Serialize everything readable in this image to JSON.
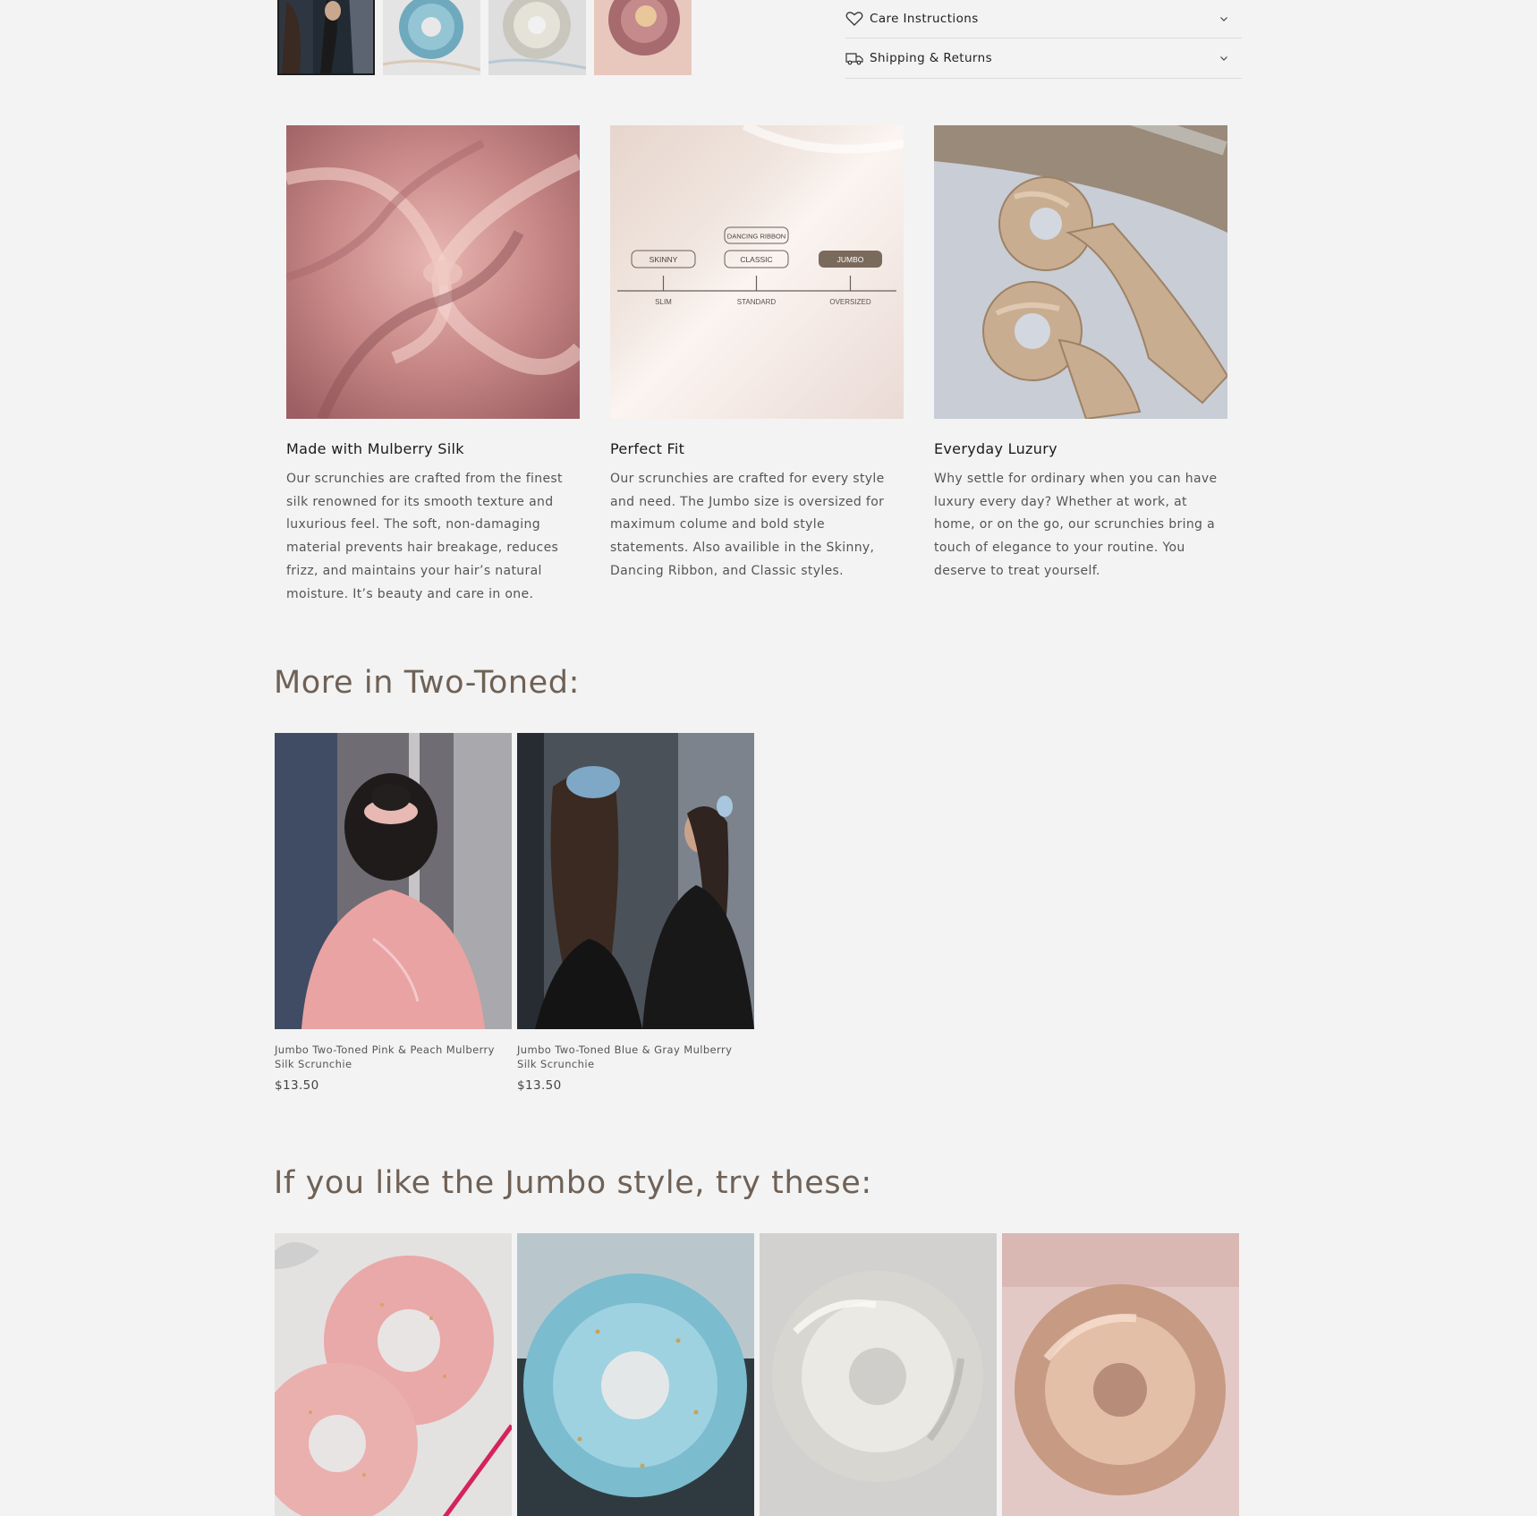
{
  "gallery": {
    "thumbnails": [
      {
        "alt": "two-toned-scrunchie-model"
      },
      {
        "alt": "blue-scrunchie"
      },
      {
        "alt": "silver-scrunchie"
      },
      {
        "alt": "rose-scrunchie"
      }
    ]
  },
  "accordions": [
    {
      "label": "Care Instructions",
      "icon": "heart-icon"
    },
    {
      "label": "Shipping & Returns",
      "icon": "truck-icon"
    }
  ],
  "features": [
    {
      "title": "Made with Mulberry Silk",
      "text": "Our scrunchies are crafted from the finest silk renowned for its smooth texture and luxurious feel. The soft, non-damaging material prevents hair breakage, reduces frizz, and maintains your hair’s natural moisture. It’s beauty and care in one."
    },
    {
      "title": "Perfect Fit",
      "text": "Our scrunchies are crafted for every style and need. The Jumbo size is oversized for maximum colume and bold style statements. Also availible in the Skinny, Dancing Ribbon, and Classic styles.",
      "size_chart": {
        "top_label": "DANCING RIBBON",
        "labels": [
          "SKINNY",
          "CLASSIC",
          "JUMBO"
        ],
        "axis": [
          "SLIM",
          "STANDARD",
          "OVERSIZED"
        ]
      }
    },
    {
      "title": "Everyday Luzury",
      "text": "Why settle for ordinary when you can have luxury every day? Whether at work, at home, or on the go, our scrunchies bring a touch of elegance to your routine. You deserve to treat yourself."
    }
  ],
  "more_two_toned": {
    "heading": "More in Two-Toned:",
    "products": [
      {
        "title": "Jumbo Two-Toned Pink & Peach Mulberry Silk Scrunchie",
        "price": "$13.50"
      },
      {
        "title": "Jumbo Two-Toned Blue & Gray Mulberry Silk Scrunchie",
        "price": "$13.50"
      }
    ]
  },
  "jumbo_style": {
    "heading": "If you like the Jumbo style, try these:"
  },
  "colors": {
    "background": "#f3f3f3",
    "heading": "#6f6156",
    "accent_jumbo": "#7a6a5c"
  }
}
